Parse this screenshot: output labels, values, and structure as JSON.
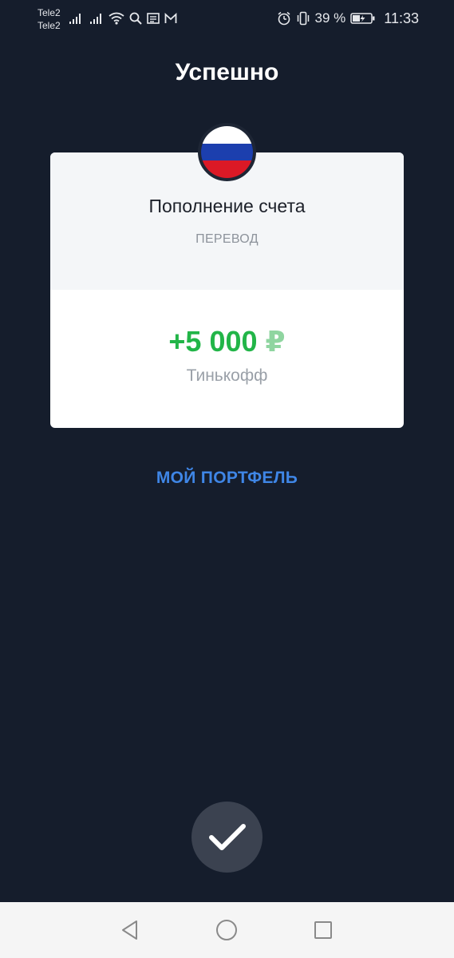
{
  "status_bar": {
    "carrier_1": "Tele2",
    "carrier_2": "Tele2",
    "battery_percent": "39 %",
    "time": "11:33"
  },
  "header": {
    "title": "Успешно"
  },
  "card": {
    "title": "Пополнение счета",
    "subtitle": "ПЕРЕВОД",
    "amount": "+5 000",
    "currency": "₽",
    "bank": "Тинькофф",
    "flag_colors": [
      "#ffffff",
      "#1c3fae",
      "#db1926"
    ],
    "amount_color": "#22b548"
  },
  "actions": {
    "portfolio_link": "МОЙ ПОРТФЕЛЬ",
    "confirm_icon": "checkmark-icon"
  },
  "nav": {
    "back_icon": "triangle-back-icon",
    "home_icon": "circle-home-icon",
    "recents_icon": "square-recents-icon"
  },
  "colors": {
    "background": "#151d2c",
    "link": "#3f86e6"
  }
}
